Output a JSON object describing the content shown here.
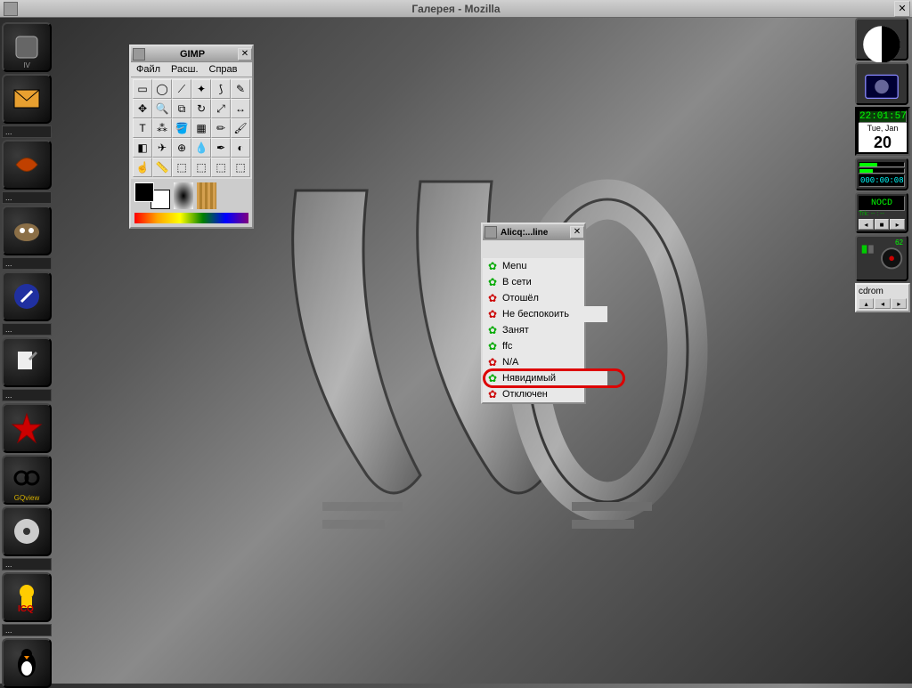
{
  "main_window": {
    "title": "Галерея - Mozilla"
  },
  "left_dock": {
    "items": [
      {
        "name": "clip",
        "label": "IV"
      },
      {
        "name": "mail",
        "label": ""
      },
      {
        "name": "ddd",
        "label": ""
      },
      {
        "name": "gimp-app",
        "label": ""
      },
      {
        "name": "brush",
        "label": ""
      },
      {
        "name": "edit",
        "label": ""
      },
      {
        "name": "star",
        "label": ""
      },
      {
        "name": "gqview",
        "label": "GQview"
      },
      {
        "name": "disc",
        "label": ""
      },
      {
        "name": "icq",
        "label": ""
      },
      {
        "name": "penguin",
        "label": ""
      }
    ],
    "ellipsis": "..."
  },
  "gimp": {
    "title": "GIMP",
    "menu": [
      "Файл",
      "Расш.",
      "Справ"
    ]
  },
  "alicq": {
    "title": "Alicq:...line",
    "items": [
      {
        "label": "Menu",
        "color": "#0a0"
      },
      {
        "label": "В сети",
        "color": "#0a0"
      },
      {
        "label": "Отошёл",
        "color": "#c00"
      },
      {
        "label": "Не беспокоить",
        "color": "#c00"
      },
      {
        "label": "Занят",
        "color": "#0a0"
      },
      {
        "label": "ffc",
        "color": "#0a0"
      },
      {
        "label": "N/A",
        "color": "#c00"
      },
      {
        "label": "Нявидимый",
        "color": "#0a0",
        "highlighted": true
      },
      {
        "label": "Отключен",
        "color": "#c00"
      }
    ]
  },
  "clock": {
    "time": "22:01:57",
    "date": "Tue, Jan",
    "day": "20"
  },
  "timer": {
    "display": "000:00:08"
  },
  "track": {
    "display": "NOCD",
    "label": "Trk: -- : --"
  },
  "mixer": {
    "label": "62"
  },
  "cdrom": {
    "label": "cdrom"
  }
}
